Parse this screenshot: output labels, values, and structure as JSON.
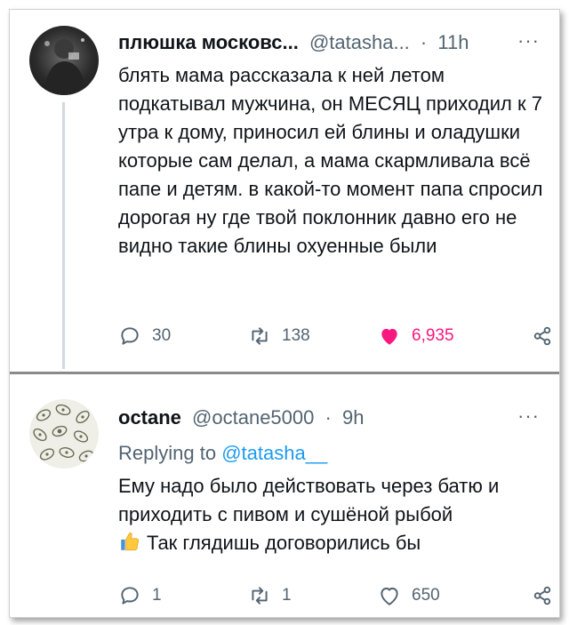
{
  "tweet1": {
    "name": "плюшка московс...",
    "handle": "@tatasha...",
    "separator": "·",
    "time": "11h",
    "more": "···",
    "text": "блять мама рассказала к ней летом подкатывал мужчина, он МЕСЯЦ приходил к 7 утра к дому, приносил ей блины и оладушки которые сам делал, а мама скармливала всё папе и детям. в какой-то момент папа спросил дорогая ну где твой поклонник давно его не видно такие блины охуенные были",
    "replies": "30",
    "retweets": "138",
    "likes": "6,935",
    "liked": true
  },
  "tweet2": {
    "name": "octane",
    "handle": "@octane5000",
    "separator": "·",
    "time": "9h",
    "more": "···",
    "replying_prefix": "Replying to",
    "replying_to": "@tatasha__",
    "text_line1": "Ему надо было действовать через батю и приходить с пивом и сушёной рыбой",
    "text_line2": "Так глядишь договорились бы",
    "replies": "1",
    "retweets": "1",
    "likes": "650",
    "liked": false
  },
  "colors": {
    "like_active": "#f91880",
    "muted": "#536471",
    "link": "#1d9bf0",
    "text": "#0f1419"
  },
  "icons": {
    "reply": "reply-icon",
    "retweet": "retweet-icon",
    "like": "heart-icon",
    "share": "share-icon",
    "emoji": "thumbs-up-emoji"
  }
}
